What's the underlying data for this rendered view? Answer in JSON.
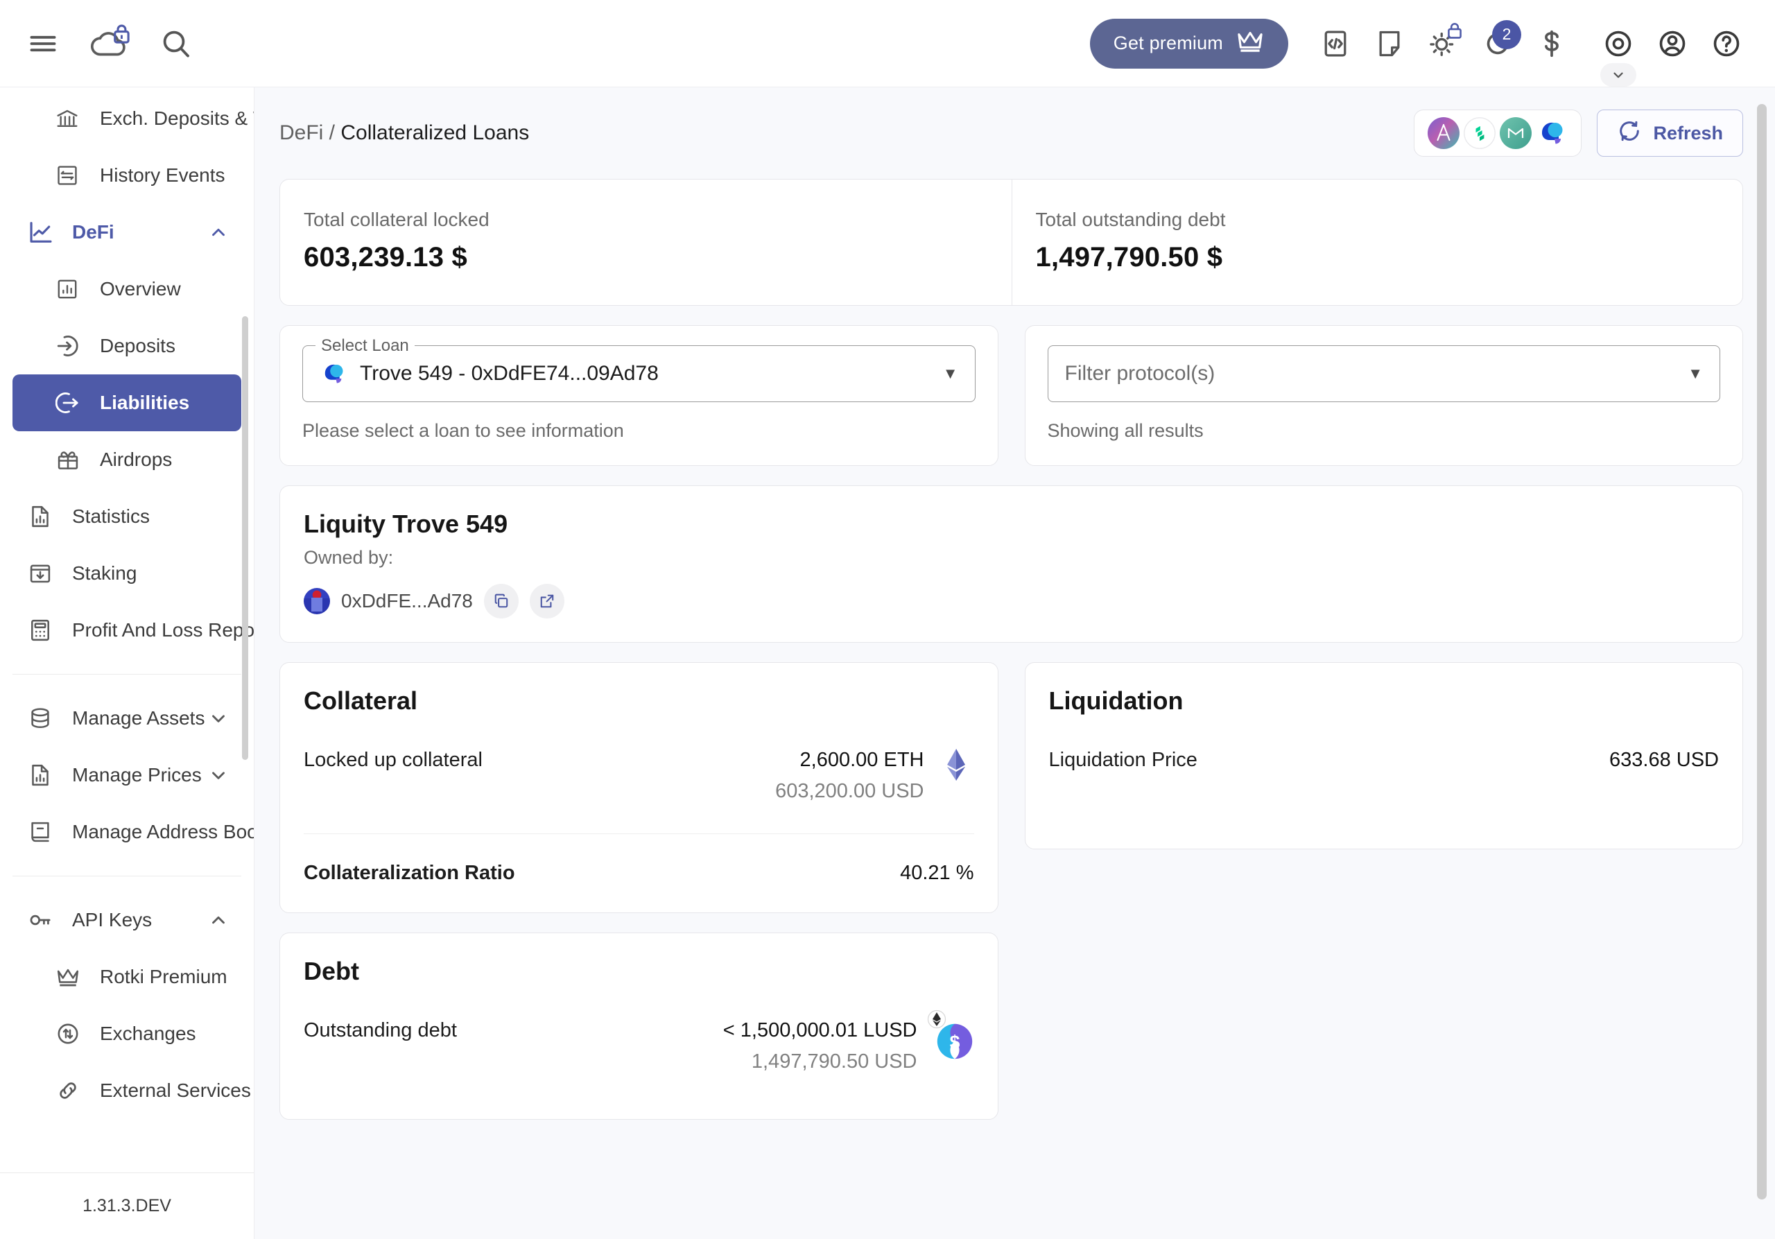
{
  "topbar": {
    "menu_icon": "hamburger-menu-icon",
    "logo_icon": "rotki-cloud-logo-icon",
    "logo_lock_icon": "lock-icon",
    "search_icon": "search-icon",
    "premium_label": "Get premium",
    "premium_icon": "crown-icon",
    "actions": [
      {
        "name": "developer-mode-icon",
        "icon": "code-brackets-icon"
      },
      {
        "name": "notes-icon",
        "icon": "note-page-icon"
      },
      {
        "name": "theme-toggle-icon",
        "icon": "sun-icon"
      },
      {
        "name": "sync-status-icon",
        "icon": "spinner-icon"
      },
      {
        "name": "currency-icon",
        "icon": "dollar-icon"
      },
      {
        "name": "privacy-mode-icon",
        "icon": "eye-icon"
      },
      {
        "name": "account-icon",
        "icon": "user-circle-icon"
      },
      {
        "name": "help-icon",
        "icon": "question-circle-icon"
      }
    ],
    "notification_count": "2"
  },
  "sidebar": {
    "items": [
      {
        "label": "Exch. Deposits & Withdrawals",
        "icon": "bank-icon",
        "level": "child",
        "state": "normal"
      },
      {
        "label": "History Events",
        "icon": "swap-box-icon",
        "level": "child",
        "state": "normal"
      },
      {
        "label": "DeFi",
        "icon": "trend-chart-icon",
        "level": "parent",
        "state": "expanded",
        "chevron": "chevron-up-icon"
      },
      {
        "label": "Overview",
        "icon": "bar-chart-box-icon",
        "level": "child",
        "state": "normal"
      },
      {
        "label": "Deposits",
        "icon": "arrow-into-circle-icon",
        "level": "child",
        "state": "normal"
      },
      {
        "label": "Liabilities",
        "icon": "arrow-out-circle-icon",
        "level": "child",
        "state": "active"
      },
      {
        "label": "Airdrops",
        "icon": "gift-icon",
        "level": "child",
        "state": "normal"
      },
      {
        "label": "Statistics",
        "icon": "file-chart-icon",
        "level": "parent",
        "state": "normal"
      },
      {
        "label": "Staking",
        "icon": "inbox-download-icon",
        "level": "parent",
        "state": "normal"
      },
      {
        "label": "Profit And Loss Report",
        "icon": "calculator-icon",
        "level": "parent",
        "state": "normal"
      },
      {
        "separator": true
      },
      {
        "label": "Manage Assets",
        "icon": "database-icon",
        "level": "parent",
        "state": "collapsed",
        "chevron": "chevron-down-icon"
      },
      {
        "label": "Manage Prices",
        "icon": "file-chart-icon",
        "level": "parent",
        "state": "collapsed",
        "chevron": "chevron-down-icon"
      },
      {
        "label": "Manage Address Book",
        "icon": "book-icon",
        "level": "parent",
        "state": "normal"
      },
      {
        "separator": true
      },
      {
        "label": "API Keys",
        "icon": "key-icon",
        "level": "parent",
        "state": "expanded",
        "chevron": "chevron-up-icon"
      },
      {
        "label": "Rotki Premium",
        "icon": "crown-icon",
        "level": "child",
        "state": "normal"
      },
      {
        "label": "Exchanges",
        "icon": "exchange-circle-icon",
        "level": "child",
        "state": "normal"
      },
      {
        "label": "External Services",
        "icon": "link-chain-icon",
        "level": "child",
        "state": "normal"
      }
    ],
    "version": "1.31.3.DEV"
  },
  "page": {
    "breadcrumb_root": "DeFi",
    "breadcrumb_sep": " / ",
    "breadcrumb_current": "Collateralized Loans",
    "protocol_icons": [
      {
        "name": "aave-protocol-icon",
        "label": "Aave",
        "color": "#b06ab3"
      },
      {
        "name": "compound-protocol-icon",
        "label": "Compound",
        "color": "#00d395"
      },
      {
        "name": "makerdao-protocol-icon",
        "label": "MakerDAO",
        "color": "#4fa89b"
      },
      {
        "name": "liquity-protocol-icon",
        "label": "Liquity",
        "color": "#1542cd"
      }
    ],
    "refresh_label": "Refresh",
    "refresh_icon": "refresh-icon"
  },
  "totals": [
    {
      "label": "Total collateral locked",
      "value": "603,239.13 $"
    },
    {
      "label": "Total outstanding debt",
      "value": "1,497,790.50 $"
    }
  ],
  "loan_select": {
    "legend": "Select Loan",
    "value": "Trove 549 - 0xDdFE74...09Ad78",
    "icon": "liquity-protocol-icon",
    "arrow_icon": "chevron-down-icon",
    "hint": "Please select a loan to see information"
  },
  "protocol_filter": {
    "placeholder": "Filter protocol(s)",
    "arrow_icon": "chevron-down-icon",
    "hint": "Showing all results"
  },
  "trove": {
    "title": "Liquity Trove 549",
    "owned_by_label": "Owned by:",
    "owner_address": "0xDdFE...Ad78",
    "avatar_icon": "address-blockie-avatar",
    "copy_icon": "copy-icon",
    "external_icon": "external-link-icon"
  },
  "collateral": {
    "title": "Collateral",
    "locked_label": "Locked up collateral",
    "locked_amount": "2,600.00 ETH",
    "locked_usd": "603,200.00 USD",
    "asset_icon": "ethereum-icon",
    "ratio_label": "Collateralization Ratio",
    "ratio_value": "40.21 %"
  },
  "liquidation": {
    "title": "Liquidation",
    "price_label": "Liquidation Price",
    "price_value": "633.68 USD"
  },
  "debt": {
    "title": "Debt",
    "outstanding_label": "Outstanding debt",
    "outstanding_amount": "< 1,500,000.01 LUSD",
    "outstanding_usd": "1,497,790.50 USD",
    "asset_icon": "lusd-icon",
    "chain_badge_icon": "ethereum-chain-badge-icon"
  },
  "colors": {
    "accent": "#4e5aa8",
    "premium_bg": "#5c6693",
    "main_bg": "#f8f9fc",
    "card_border": "#e6e6ea"
  }
}
